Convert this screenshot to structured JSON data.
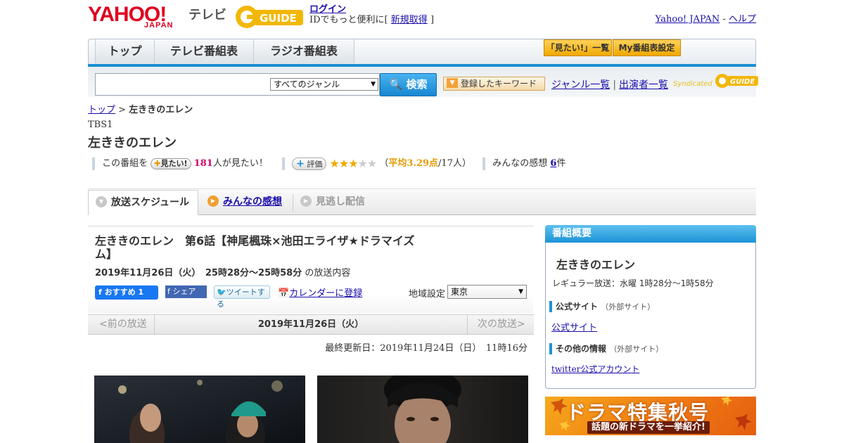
{
  "header": {
    "logo_text": "YAHOO!",
    "logo_sub": "JAPAN",
    "tv_label": "テレビ",
    "gguide_label": "GUIDE",
    "login_label": "ログイン",
    "id_text_prefix": "IDでもっと便利に[",
    "signup_label": "新規取得",
    "id_text_suffix": "]",
    "yahoo_japan_link": "Yahoo! JAPAN",
    "help_link": "ヘルプ",
    "dash": "-"
  },
  "nav": {
    "tabs": [
      "トップ",
      "テレビ番組表",
      "ラジオ番組表"
    ],
    "mitai_list": "「見たい!」一覧",
    "my_schedule": "My番組表設定"
  },
  "search": {
    "genre_selected": "すべてのジャンル",
    "search_button": "検索",
    "keyword_button": "登録したキーワード",
    "genre_list_link": "ジャンル一覧",
    "separator": "|",
    "performer_list_link": "出演者一覧",
    "syndicated": "Syndicated"
  },
  "breadcrumb": {
    "top": "トップ",
    "sep": ">",
    "current": "左ききのエレン"
  },
  "program": {
    "channel": "TBS1",
    "title": "左ききのエレン",
    "stats_prefix": "この番組を",
    "mitai_button": "見たい!",
    "mitai_count": "181",
    "mitai_suffix": "人が見たい！",
    "rating_button": "評価",
    "rating_value": 3.29,
    "rating_stars": 3,
    "rating_text_open": "（",
    "rating_avg": "平均3.29点",
    "rating_count": "/17人）",
    "kansou_label": "みんなの感想",
    "kansou_count": "6",
    "kansou_unit": "件"
  },
  "tabs": {
    "schedule": "放送スケジュール",
    "reviews": "みんなの感想",
    "missed": "見逃し配信"
  },
  "episode": {
    "title": "左ききのエレン　第6話【神尾楓珠×池田エライザ★ドラマイズム】",
    "date": "2019年11月26日（火）　25時28分～25時58分",
    "date_suffix": "の放送内容",
    "fb_recommend": "おすすめ 1",
    "fb_share": "シェア",
    "tweet": "ツイートする",
    "calendar": "カレンダーに登録",
    "region_label": "地域設定",
    "region_value": "東京"
  },
  "pager": {
    "prev": "<前の放送",
    "date": "2019年11月26日（火）",
    "next": "次の放送>"
  },
  "updated": "最終更新日：2019年11月24日（日）　11時16分",
  "sidebar": {
    "heading": "番組概要",
    "title": "左ききのエレン",
    "regular": "レギュラー放送：水曜 1時28分～1時58分",
    "official_heading": "公式サイト",
    "official_ext": "（外部サイト）",
    "official_link": "公式サイト",
    "other_heading": "その他の情報",
    "other_ext": "（外部サイト）",
    "twitter_link": "twitter公式アカウント"
  },
  "banner": {
    "line1": "ドラマ特集秋号",
    "line2": "話題の新ドラマを一挙紹介!"
  },
  "colors": {
    "accent_blue": "#1b8fd3",
    "yahoo_red": "#e0001e",
    "gold": "#f0a800",
    "pink": "#d6006b"
  }
}
